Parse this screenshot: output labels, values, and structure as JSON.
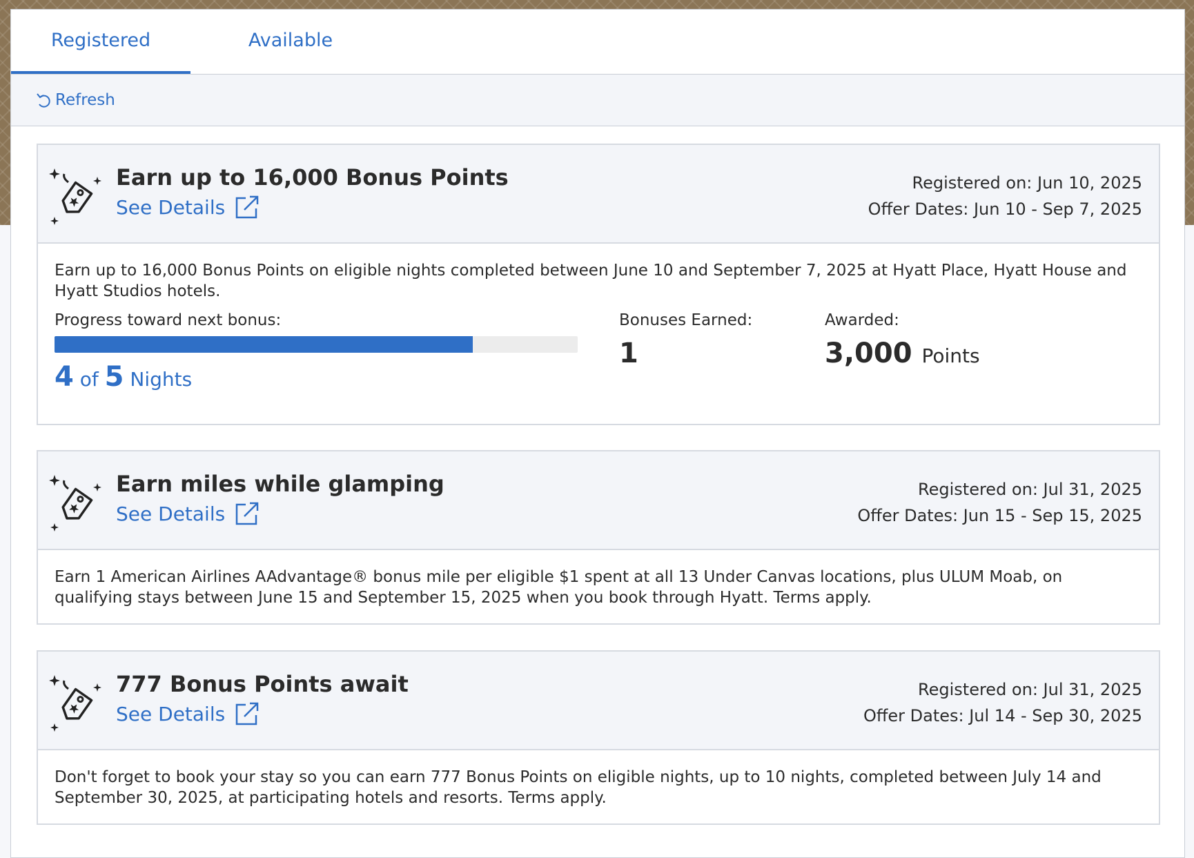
{
  "tabs": [
    {
      "label": "Registered",
      "active": true
    },
    {
      "label": "Available",
      "active": false
    }
  ],
  "toolbar": {
    "refresh_label": "Refresh",
    "refresh_icon": "refresh-icon"
  },
  "colors": {
    "accent": "#2f6fc6",
    "progress_track": "#ececec",
    "header_bg": "#f3f5f9"
  },
  "offers": [
    {
      "title": "Earn up to 16,000 Bonus Points",
      "see_details": "See Details",
      "registered_on": "Registered on: Jun 10, 2025",
      "offer_dates": "Offer Dates: Jun 10 - Sep 7, 2025",
      "description": "Earn up to 16,000 Bonus Points on eligible nights completed between June 10 and September 7, 2025 at Hyatt Place, Hyatt House and Hyatt Studios hotels.",
      "progress": {
        "label": "Progress toward next bonus:",
        "current": "4",
        "of": "of",
        "total": "5",
        "unit": "Nights",
        "fraction": 0.8
      },
      "bonuses_earned": {
        "label": "Bonuses Earned:",
        "value": "1"
      },
      "awarded": {
        "label": "Awarded:",
        "value": "3,000",
        "unit": "Points"
      }
    },
    {
      "title": "Earn miles while glamping",
      "see_details": "See Details",
      "registered_on": "Registered on: Jul 31, 2025",
      "offer_dates": "Offer Dates: Jun 15 - Sep 15, 2025",
      "description": "Earn 1 American Airlines AAdvantage® bonus mile per eligible $1 spent at all 13 Under Canvas locations, plus ULUM Moab, on qualifying stays between June 15 and September 15, 2025 when you book through Hyatt. Terms apply."
    },
    {
      "title": "777 Bonus Points await",
      "see_details": "See Details",
      "registered_on": "Registered on: Jul 31, 2025",
      "offer_dates": "Offer Dates: Jul 14 - Sep 30, 2025",
      "description": "Don't forget to book your stay so you can earn 777 Bonus Points on eligible nights, up to 10 nights, completed between July 14 and September 30, 2025, at participating hotels and resorts. Terms apply."
    }
  ]
}
